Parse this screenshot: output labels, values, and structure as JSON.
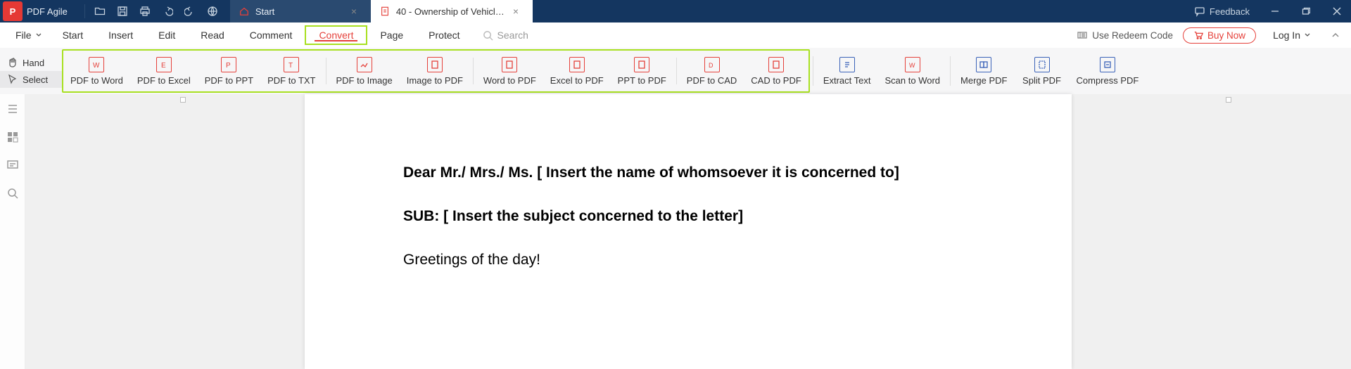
{
  "app": {
    "name": "PDF Agile"
  },
  "titlebar": {
    "tabs": {
      "home_label": "Start",
      "file_label": "40 - Ownership of Vehicle Tr..."
    },
    "feedback": "Feedback"
  },
  "menu": {
    "file": "File",
    "items": {
      "start": "Start",
      "insert": "Insert",
      "edit": "Edit",
      "read": "Read",
      "comment": "Comment",
      "convert": "Convert",
      "page": "Page",
      "protect": "Protect"
    },
    "search_placeholder": "Search",
    "redeem": "Use Redeem Code",
    "buy": "Buy Now",
    "login": "Log In"
  },
  "ribbon": {
    "left": {
      "hand": "Hand",
      "select": "Select"
    },
    "buttons": {
      "pdf_to_word": "PDF to Word",
      "pdf_to_excel": "PDF to Excel",
      "pdf_to_ppt": "PDF to PPT",
      "pdf_to_txt": "PDF to TXT",
      "pdf_to_image": "PDF to Image",
      "image_to_pdf": "Image to PDF",
      "word_to_pdf": "Word to PDF",
      "excel_to_pdf": "Excel to PDF",
      "ppt_to_pdf": "PPT to PDF",
      "pdf_to_cad": "PDF to CAD",
      "cad_to_pdf": "CAD to PDF",
      "extract_text": "Extract Text",
      "scan_to_word": "Scan to Word",
      "merge_pdf": "Merge PDF",
      "split_pdf": "Split PDF",
      "compress_pdf": "Compress PDF"
    }
  },
  "document": {
    "salutation": "Dear Mr./ Mrs./ Ms. [ Insert the name of whomsoever it is concerned to]",
    "subject": "SUB: [ Insert the subject concerned to the letter]",
    "greeting": "Greetings of the day!"
  }
}
